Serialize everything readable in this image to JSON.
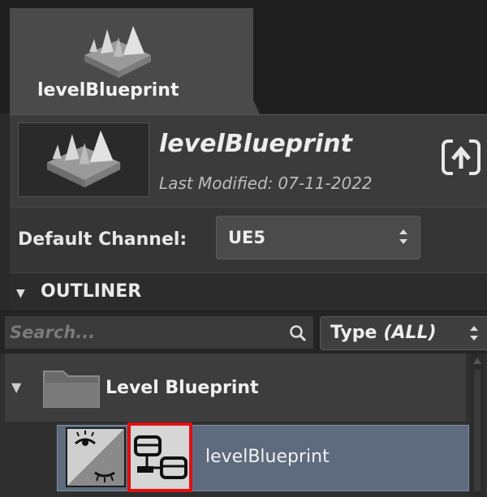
{
  "tab": {
    "label": "levelBlueprint",
    "icon": "level-blueprint-icon"
  },
  "header": {
    "title": "levelBlueprint",
    "modified_label": "Last Modified:",
    "modified_date": "07-11-2022",
    "export_icon": "export-icon"
  },
  "channel": {
    "label": "Default Channel:",
    "value": "UE5"
  },
  "outliner": {
    "title": "OUTLINER",
    "search_placeholder": "Search...",
    "type_label": "Type",
    "type_value": "(ALL)"
  },
  "tree": {
    "folder_label": "Level Blueprint",
    "item_label": "levelBlueprint"
  },
  "colors": {
    "selection": "#5e6b7e",
    "highlight": "#e01010"
  }
}
